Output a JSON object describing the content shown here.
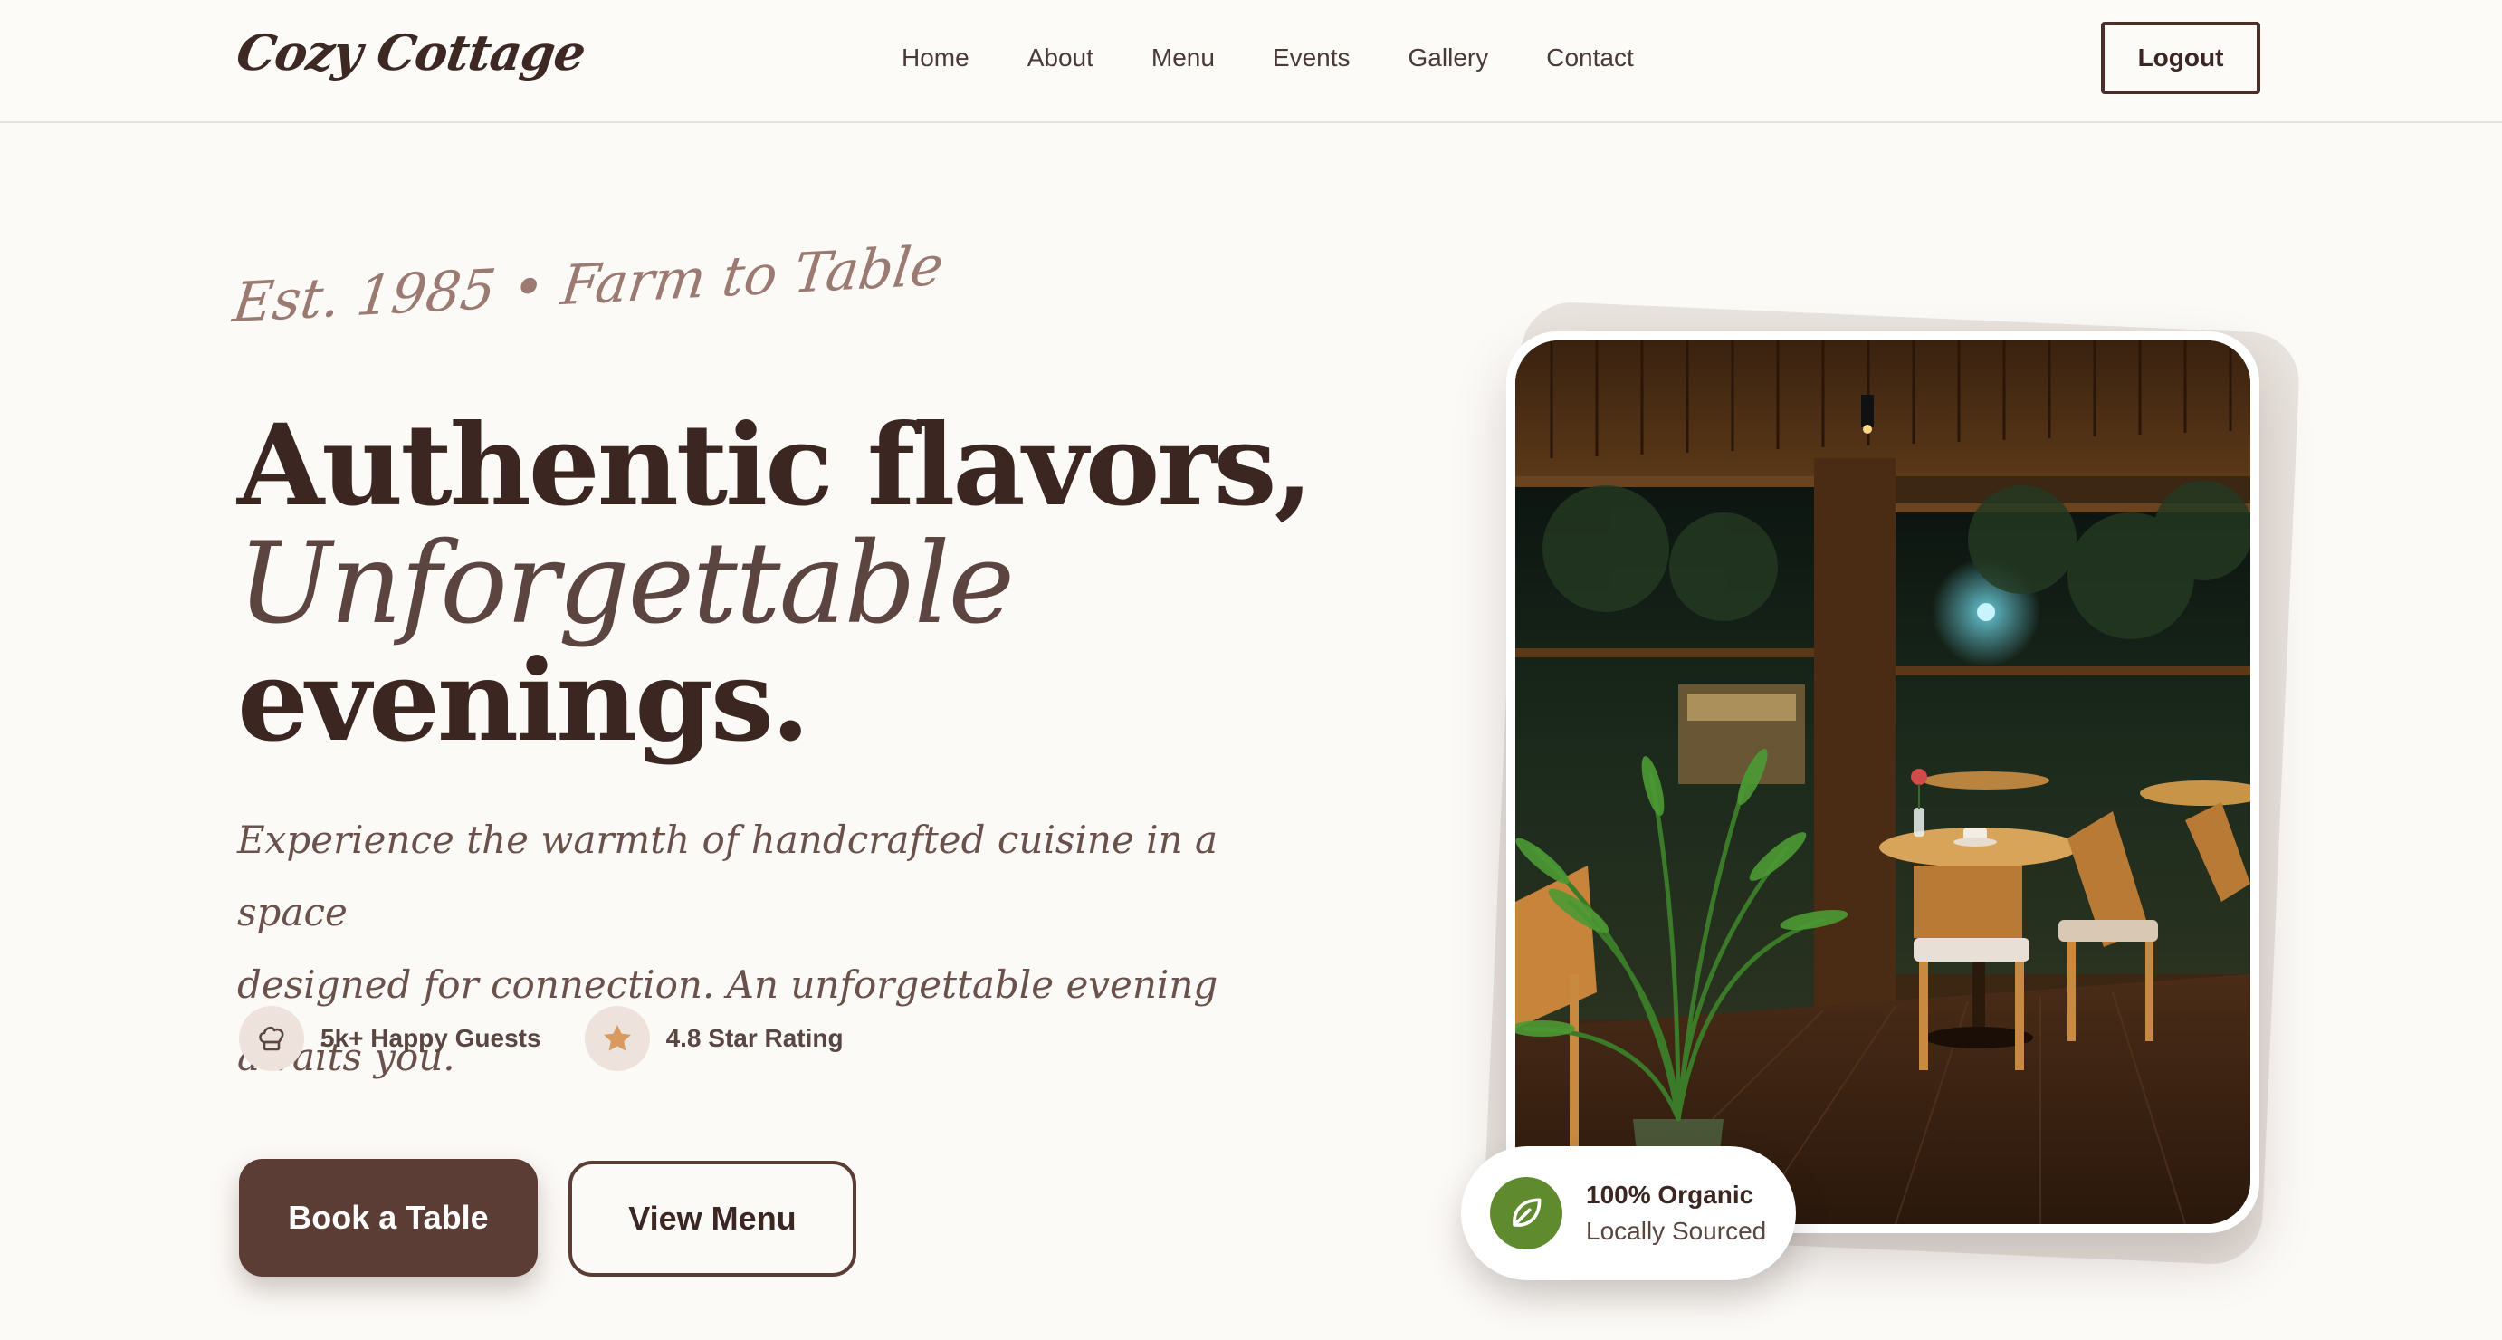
{
  "header": {
    "logo": "Cozy Cottage",
    "nav": [
      "Home",
      "About",
      "Menu",
      "Events",
      "Gallery",
      "Contact"
    ],
    "logout_label": "Logout"
  },
  "hero": {
    "tagline": "Est. 1985 • Farm to Table",
    "headline_line1": "Authentic flavors,",
    "headline_line2": "Unforgettable",
    "headline_line3": "evenings.",
    "subtitle_line1": "Experience the warmth of handcrafted cuisine in a space",
    "subtitle_line2": "designed for connection. An unforgettable evening awaits you.",
    "stats": [
      {
        "icon": "chef-hat-icon",
        "label": "5k+ Happy Guests"
      },
      {
        "icon": "star-icon",
        "label": "4.8 Star Rating"
      }
    ],
    "primary_button": "Book a Table",
    "secondary_button": "View Menu"
  },
  "badge": {
    "icon": "leaf-icon",
    "title": "100% Organic",
    "subtitle": "Locally Sourced"
  },
  "colors": {
    "primary": "#5c3d36",
    "text": "#3b2622",
    "background": "#fcfaf7",
    "accent_green": "#5f8a2e",
    "star": "#d89a5e"
  }
}
